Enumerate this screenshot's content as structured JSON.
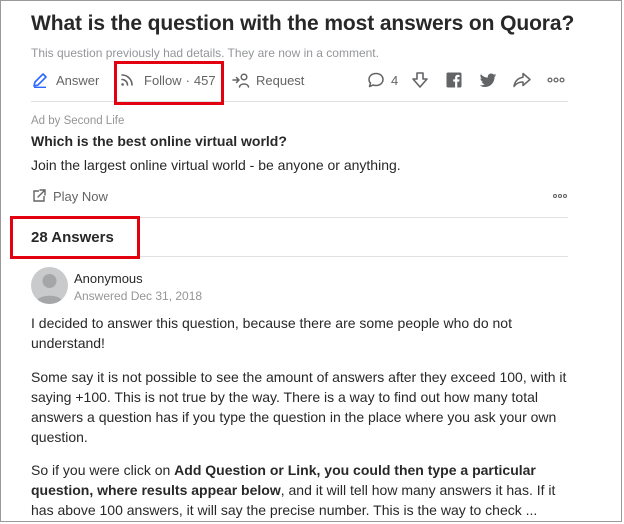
{
  "question": {
    "title": "What is the question with the most answers on Quora?",
    "note": "This question previously had details. They are now in a comment."
  },
  "actions": {
    "answer_label": "Answer",
    "follow_label": "Follow",
    "follow_sep": "·",
    "follow_count": "457",
    "request_label": "Request",
    "comment_count": "4",
    "icons": [
      "pencil-icon",
      "follow-icon",
      "request-icon",
      "comment-icon",
      "downvote-icon",
      "facebook-icon",
      "twitter-icon",
      "share-icon",
      "more-icon"
    ]
  },
  "ad": {
    "by": "Ad by Second Life",
    "title": "Which is the best online virtual world?",
    "description": "Join the largest online virtual world - be anyone or anything.",
    "cta": "Play Now"
  },
  "answers_header": "28 Answers",
  "answer": {
    "author": "Anonymous",
    "date": "Answered Dec 31, 2018",
    "p1": "I decided to answer this question, because there are some people who do not understand!",
    "p2": "Some say it is not possible to see the amount of answers after they exceed 100, with it saying +100. This is not true by the way. There is a way to find out how many total answers a question has if you type the question in the place where you ask your own question.",
    "p3_pre": "So if you were click on ",
    "p3_bold": "Add Question or Link, you could then type a particular question, where results appear below",
    "p3_post": ", and it will tell how many answers it has. If it has above 100 answers, it will say the precise number. This is the way to check ..."
  },
  "colors": {
    "highlight": "#e3000f",
    "text": "#282829",
    "muted": "#636466",
    "light": "#939598"
  }
}
